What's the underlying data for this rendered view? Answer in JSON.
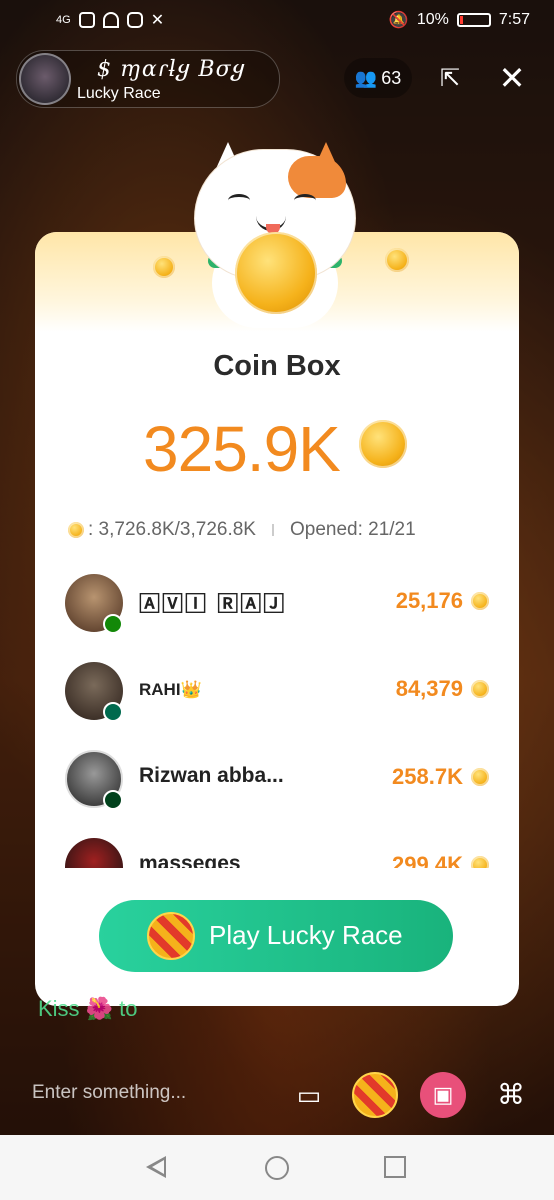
{
  "status_bar": {
    "network": "4G",
    "battery": "10%",
    "time": "7:57"
  },
  "header": {
    "host_name": "$ ɱαɾƚყ Bσყ",
    "room_name": "Lucky Race",
    "viewers": "63"
  },
  "coin_box": {
    "title": "Coin Box",
    "amount": "325.9K",
    "progress": ": 3,726.8K/3,726.8K",
    "opened": "Opened: 21/21",
    "rows": [
      {
        "name": "🄰🅅🄸 🅁🄰🄹",
        "value": "25,176",
        "flag": "#138808"
      },
      {
        "name": "RAHI👑",
        "value": "84,379",
        "flag": "#006a4e"
      },
      {
        "name": "Rizwan abba...",
        "value": "258.7K",
        "flag": "#01411c"
      },
      {
        "name": "masseges",
        "value": "299.4K",
        "flag": "#333333"
      }
    ],
    "play_button": "Play Lucky Race"
  },
  "chat": {
    "message": "Kiss 🌺 to",
    "input_placeholder": "Enter something..."
  },
  "icons": {
    "viewers": "people-icon",
    "share": "share-icon",
    "close": "close-icon",
    "chat": "chat-icon",
    "gift": "gift-icon",
    "more": "grid-icon"
  },
  "colors": {
    "accent_orange": "#f28a1f",
    "button_green": "#19b37c"
  }
}
